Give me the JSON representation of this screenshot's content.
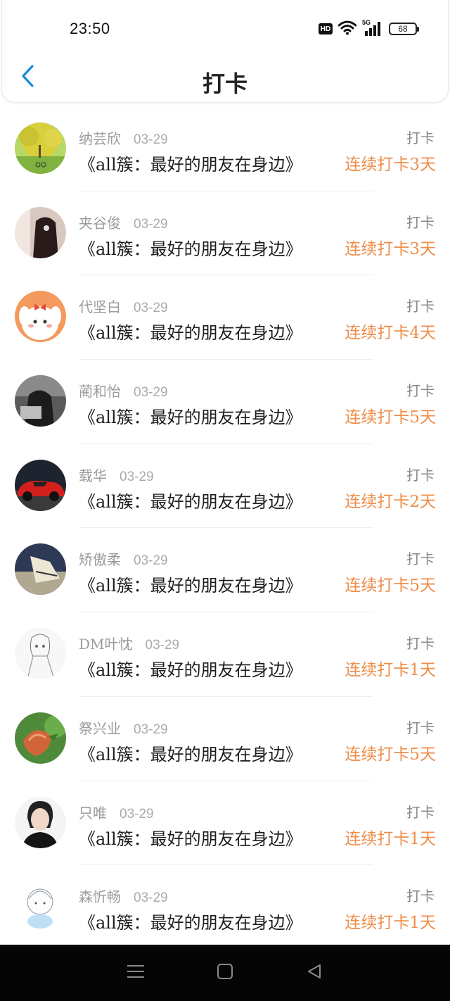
{
  "status_bar": {
    "time": "23:50",
    "hd_label": "HD",
    "network_label": "5G",
    "battery": "68"
  },
  "header": {
    "title": "打卡",
    "back_icon": "chevron-left-icon",
    "accent_color": "#1a8cd8"
  },
  "feed": {
    "items": [
      {
        "username": "纳芸欣",
        "date": "03-29",
        "type": "打卡",
        "book": "《all簇：最好的朋友在身边》",
        "streak": "连续打卡3天"
      },
      {
        "username": "夹谷俊",
        "date": "03-29",
        "type": "打卡",
        "book": "《all簇：最好的朋友在身边》",
        "streak": "连续打卡3天"
      },
      {
        "username": "代坚白",
        "date": "03-29",
        "type": "打卡",
        "book": "《all簇：最好的朋友在身边》",
        "streak": "连续打卡4天"
      },
      {
        "username": "蔺和怡",
        "date": "03-29",
        "type": "打卡",
        "book": "《all簇：最好的朋友在身边》",
        "streak": "连续打卡5天"
      },
      {
        "username": "载华",
        "date": "03-29",
        "type": "打卡",
        "book": "《all簇：最好的朋友在身边》",
        "streak": "连续打卡2天"
      },
      {
        "username": "矫傲柔",
        "date": "03-29",
        "type": "打卡",
        "book": "《all簇：最好的朋友在身边》",
        "streak": "连续打卡5天"
      },
      {
        "username": "DM叶忱",
        "date": "03-29",
        "type": "打卡",
        "book": "《all簇：最好的朋友在身边》",
        "streak": "连续打卡1天"
      },
      {
        "username": "祭兴业",
        "date": "03-29",
        "type": "打卡",
        "book": "《all簇：最好的朋友在身边》",
        "streak": "连续打卡5天"
      },
      {
        "username": "只唯",
        "date": "03-29",
        "type": "打卡",
        "book": "《all簇：最好的朋友在身边》",
        "streak": "连续打卡1天"
      },
      {
        "username": "森忻畅",
        "date": "03-29",
        "type": "打卡",
        "book": "《all簇：最好的朋友在身边》",
        "streak": "连续打卡1天"
      }
    ],
    "streak_color": "#ef8d4a"
  },
  "system_nav": {
    "icons": [
      "menu-icon",
      "home-square-icon",
      "back-triangle-icon"
    ]
  }
}
